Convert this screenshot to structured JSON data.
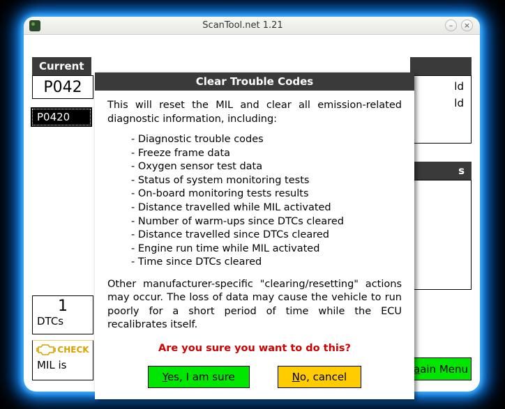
{
  "window": {
    "title": "ScanTool.net 1.21"
  },
  "background": {
    "current_header": "Current",
    "code_display": "P042",
    "selected_code": "P0420",
    "right_label1": "ld",
    "right_label2": "ld",
    "right_header2": "s",
    "dtc_count": "1",
    "dtc_label": "DTCs",
    "check_label": "CHECK",
    "mil_text": "MIL is",
    "main_menu_label": "ain Menu",
    "main_menu_ul": "a"
  },
  "dialog": {
    "title": "Clear Trouble Codes",
    "intro": "This will reset the MIL and clear all emission-related diagnostic information, including:",
    "items": [
      "Diagnostic trouble codes",
      "Freeze frame data",
      "Oxygen sensor test data",
      "Status of system monitoring tests",
      "On-board monitoring tests results",
      "Distance travelled while MIL activated",
      "Number of warm-ups since DTCs cleared",
      "Distance travelled since DTCs cleared",
      "Engine run time while MIL activated",
      "Time since DTCs cleared"
    ],
    "outro": "Other manufacturer-specific \"clearing/resetting\" actions may occur. The loss of data may cause the vehicle to run poorly for a short period of time while the ECU recalibrates itself.",
    "warning": "Are you sure you want to do this?",
    "yes_pre": "Y",
    "yes_post": "es, I am sure",
    "no_pre": "N",
    "no_post": "o, cancel"
  }
}
